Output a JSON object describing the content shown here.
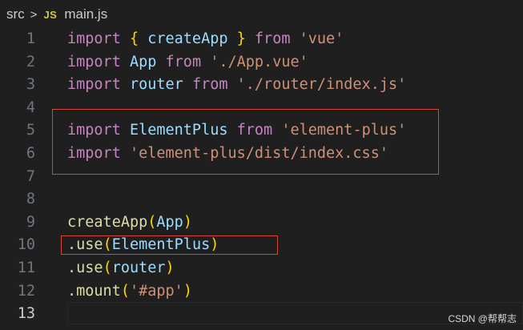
{
  "breadcrumb": {
    "folder": "src",
    "chevron": ">",
    "file_icon": "JS",
    "file_icon_name": "javascript-file-icon",
    "file": "main.js"
  },
  "editor": {
    "active_line": "13",
    "lines": [
      {
        "num": "1",
        "tokens": [
          {
            "t": "import",
            "c": "kw"
          },
          {
            "t": " ",
            "c": "pun"
          },
          {
            "t": "{",
            "c": "br1"
          },
          {
            "t": " createApp ",
            "c": "var"
          },
          {
            "t": "}",
            "c": "br1"
          },
          {
            "t": " ",
            "c": "pun"
          },
          {
            "t": "from",
            "c": "kw"
          },
          {
            "t": " ",
            "c": "pun"
          },
          {
            "t": "'vue'",
            "c": "str"
          }
        ]
      },
      {
        "num": "2",
        "tokens": [
          {
            "t": "import",
            "c": "kw"
          },
          {
            "t": " ",
            "c": "pun"
          },
          {
            "t": "App",
            "c": "var"
          },
          {
            "t": " ",
            "c": "pun"
          },
          {
            "t": "from",
            "c": "kw"
          },
          {
            "t": " ",
            "c": "pun"
          },
          {
            "t": "'./App.vue'",
            "c": "str"
          }
        ]
      },
      {
        "num": "3",
        "tokens": [
          {
            "t": "import",
            "c": "kw"
          },
          {
            "t": " ",
            "c": "pun"
          },
          {
            "t": "router",
            "c": "var"
          },
          {
            "t": " ",
            "c": "pun"
          },
          {
            "t": "from",
            "c": "kw"
          },
          {
            "t": " ",
            "c": "pun"
          },
          {
            "t": "'./router/index.js'",
            "c": "str"
          }
        ]
      },
      {
        "num": "4",
        "tokens": []
      },
      {
        "num": "5",
        "tokens": [
          {
            "t": "import",
            "c": "kw"
          },
          {
            "t": " ",
            "c": "pun"
          },
          {
            "t": "ElementPlus",
            "c": "var"
          },
          {
            "t": " ",
            "c": "pun"
          },
          {
            "t": "from",
            "c": "kw"
          },
          {
            "t": " ",
            "c": "pun"
          },
          {
            "t": "'element-plus'",
            "c": "str"
          }
        ]
      },
      {
        "num": "6",
        "tokens": [
          {
            "t": "import",
            "c": "kw"
          },
          {
            "t": " ",
            "c": "pun"
          },
          {
            "t": "'element-plus/dist/index.css'",
            "c": "str"
          }
        ]
      },
      {
        "num": "7",
        "tokens": []
      },
      {
        "num": "8",
        "tokens": []
      },
      {
        "num": "9",
        "tokens": [
          {
            "t": "createApp",
            "c": "fn"
          },
          {
            "t": "(",
            "c": "br1"
          },
          {
            "t": "App",
            "c": "var"
          },
          {
            "t": ")",
            "c": "br1"
          }
        ]
      },
      {
        "num": "10",
        "tokens": [
          {
            "t": ".",
            "c": "pun"
          },
          {
            "t": "use",
            "c": "fn"
          },
          {
            "t": "(",
            "c": "br1"
          },
          {
            "t": "ElementPlus",
            "c": "var"
          },
          {
            "t": ")",
            "c": "br1"
          }
        ]
      },
      {
        "num": "11",
        "tokens": [
          {
            "t": ".",
            "c": "pun"
          },
          {
            "t": "use",
            "c": "fn"
          },
          {
            "t": "(",
            "c": "br1"
          },
          {
            "t": "router",
            "c": "var"
          },
          {
            "t": ")",
            "c": "br1"
          }
        ]
      },
      {
        "num": "12",
        "tokens": [
          {
            "t": ".",
            "c": "pun"
          },
          {
            "t": "mount",
            "c": "fn"
          },
          {
            "t": "(",
            "c": "br1"
          },
          {
            "t": "'#app'",
            "c": "str"
          },
          {
            "t": ")",
            "c": "br1"
          }
        ]
      },
      {
        "num": "13",
        "tokens": []
      }
    ]
  },
  "colors": {
    "background": "#1f1f1f",
    "keyword": "#c586c0",
    "variable": "#9cdcfe",
    "function": "#dcdcaa",
    "string": "#ce9178",
    "bracket": "#ffd700",
    "annotation_box": "#d9433a"
  },
  "watermark": "CSDN @帮帮志"
}
